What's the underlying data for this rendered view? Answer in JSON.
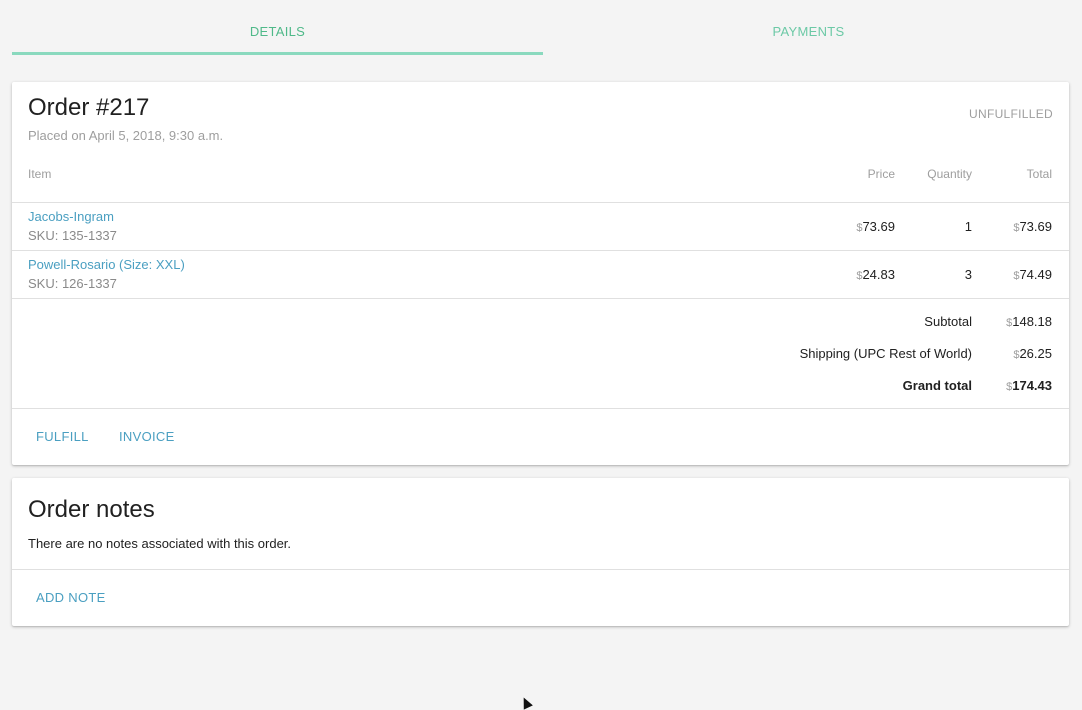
{
  "tabs": {
    "details": "DETAILS",
    "payments": "PAYMENTS"
  },
  "order": {
    "title": "Order #217",
    "placed": "Placed on April 5, 2018, 9:30 a.m.",
    "status": "UNFULFILLED",
    "columns": {
      "item": "Item",
      "price": "Price",
      "quantity": "Quantity",
      "total": "Total"
    },
    "currency_symbol": "$",
    "lines": [
      {
        "name": "Jacobs-Ingram",
        "sku": "SKU: 135-1337",
        "price": "73.69",
        "quantity": "1",
        "total": "73.69"
      },
      {
        "name": "Powell-Rosario (Size: XXL)",
        "sku": "SKU: 126-1337",
        "price": "24.83",
        "quantity": "3",
        "total": "74.49"
      }
    ],
    "summary": {
      "subtotal_label": "Subtotal",
      "subtotal": "148.18",
      "shipping_label": "Shipping (UPC Rest of World)",
      "shipping": "26.25",
      "grand_total_label": "Grand total",
      "grand_total": "174.43"
    },
    "actions": {
      "fulfill": "FULFILL",
      "invoice": "INVOICE"
    }
  },
  "notes": {
    "title": "Order notes",
    "empty_text": "There are no notes associated with this order.",
    "add_note": "ADD NOTE"
  },
  "colors": {
    "accent_green": "#4fb989",
    "link_blue": "#4a9fc1",
    "muted_text": "#9e9e9e"
  }
}
